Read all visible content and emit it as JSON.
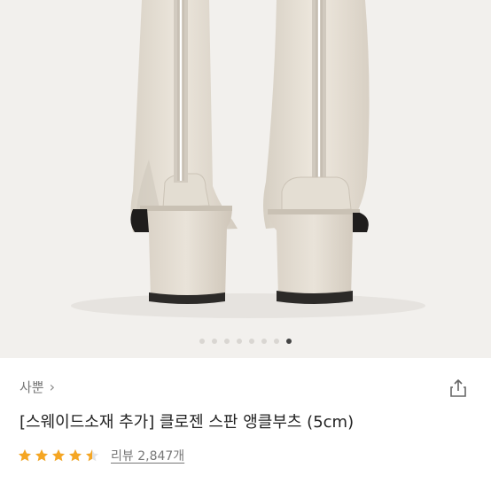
{
  "product": {
    "brand": "사뿐",
    "brand_chevron": "›",
    "title": "[스웨이드소재 추가] 클로젠 스판 앵클부츠 (5cm)",
    "rating": 4.5,
    "star_color": "#f5a623",
    "review_text": "리뷰 2,847개"
  },
  "gallery": {
    "slide_count": 8,
    "active_index": 7
  },
  "icons": {
    "share": "share-icon",
    "star": "star-icon"
  }
}
